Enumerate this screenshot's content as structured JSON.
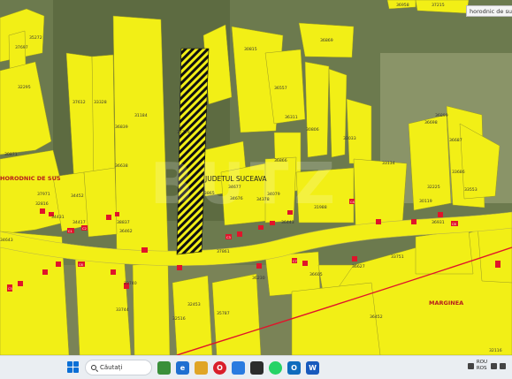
{
  "search_hint": "horodnic de sus",
  "watermark": "BUTZ",
  "labels": {
    "county": "JUDETUL SUCEAVA",
    "village_left": "HORODNIC DE SUS",
    "village_right": "MARGINEA"
  },
  "parcels": [
    "36958",
    "37215",
    "35272",
    "37697",
    "32295",
    "30815",
    "36869",
    "37612",
    "33328",
    "31184",
    "37719",
    "36557",
    "30871",
    "36839",
    "36311",
    "30806",
    "33033",
    "36899",
    "36698",
    "36687",
    "36638",
    "36866",
    "33134",
    "32225",
    "33553",
    "33686",
    "37971",
    "32816",
    "34431",
    "34452",
    "34417",
    "38837",
    "33865",
    "34677",
    "34676",
    "34079",
    "34378",
    "31988",
    "36443",
    "34643",
    "37861",
    "33751",
    "36627",
    "36605",
    "36462",
    "36230",
    "33740",
    "32453",
    "35787",
    "32516",
    "33744",
    "36452",
    "32116",
    "36931",
    "30119"
  ],
  "house_tags": [
    "C1",
    "C2",
    "C3",
    "C4",
    "C5",
    "C6",
    "C7",
    "C8"
  ],
  "taskbar": {
    "search_placeholder": "Căutați",
    "lang_top": "ROU",
    "lang_bottom": "ROS"
  },
  "colors": {
    "parcel_fill": "#f2ef16",
    "house_fill": "#e0142a",
    "road_line": "#e0142a",
    "hatch_stroke": "#111111"
  },
  "icons": [
    "start-icon",
    "search-icon",
    "app-icon",
    "edge-icon",
    "file-explorer-icon",
    "opera-icon",
    "store-icon",
    "whatsapp-icon",
    "outlook-icon",
    "word-icon"
  ]
}
